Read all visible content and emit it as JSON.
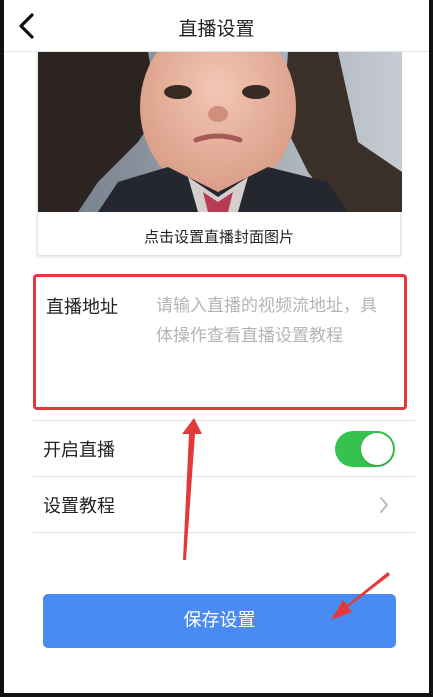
{
  "header": {
    "title": "直播设置",
    "back_icon": "chevron-left-icon"
  },
  "cover": {
    "caption": "点击设置直播封面图片"
  },
  "stream": {
    "label": "直播地址",
    "value": "",
    "placeholder": "请输入直播的视频流地址，具体操作查看直播设置教程"
  },
  "live_toggle": {
    "label": "开启直播",
    "on": true,
    "color": "#36c24f"
  },
  "tutorial": {
    "label": "设置教程",
    "icon": "chevron-right-icon"
  },
  "save_button": {
    "label": "保存设置",
    "color": "#4a8bf1"
  },
  "annotations": {
    "highlight_color": "#e23a3a"
  }
}
